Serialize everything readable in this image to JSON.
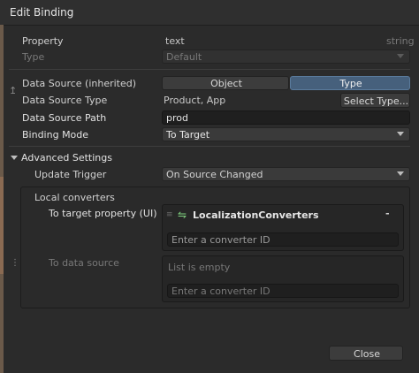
{
  "window": {
    "title": "Edit Binding"
  },
  "property": {
    "label": "Property",
    "value": "text",
    "type": "string"
  },
  "type_row": {
    "label": "Type",
    "value": "Default"
  },
  "data_source": {
    "label": "Data Source (inherited)",
    "object_label": "Object",
    "type_label": "Type",
    "selected": "Type"
  },
  "data_source_type": {
    "label": "Data Source Type",
    "value": "Product, App",
    "button": "Select Type..."
  },
  "data_source_path": {
    "label": "Data Source Path",
    "value": "prod"
  },
  "binding_mode": {
    "label": "Binding Mode",
    "value": "To Target"
  },
  "advanced": {
    "header": "Advanced Settings",
    "update_trigger": {
      "label": "Update Trigger",
      "value": "On Source Changed"
    },
    "local_converters": {
      "header": "Local converters",
      "to_target": {
        "label": "To target property (UI)",
        "item": "LocalizationConverters",
        "remove": "-",
        "placeholder": "Enter a converter ID"
      },
      "to_source": {
        "label": "To data source",
        "empty_text": "List is empty",
        "placeholder": "Enter a converter ID"
      }
    }
  },
  "footer": {
    "close": "Close"
  },
  "colors": {
    "accent": "#46607c",
    "background": "#2b2b2b"
  }
}
